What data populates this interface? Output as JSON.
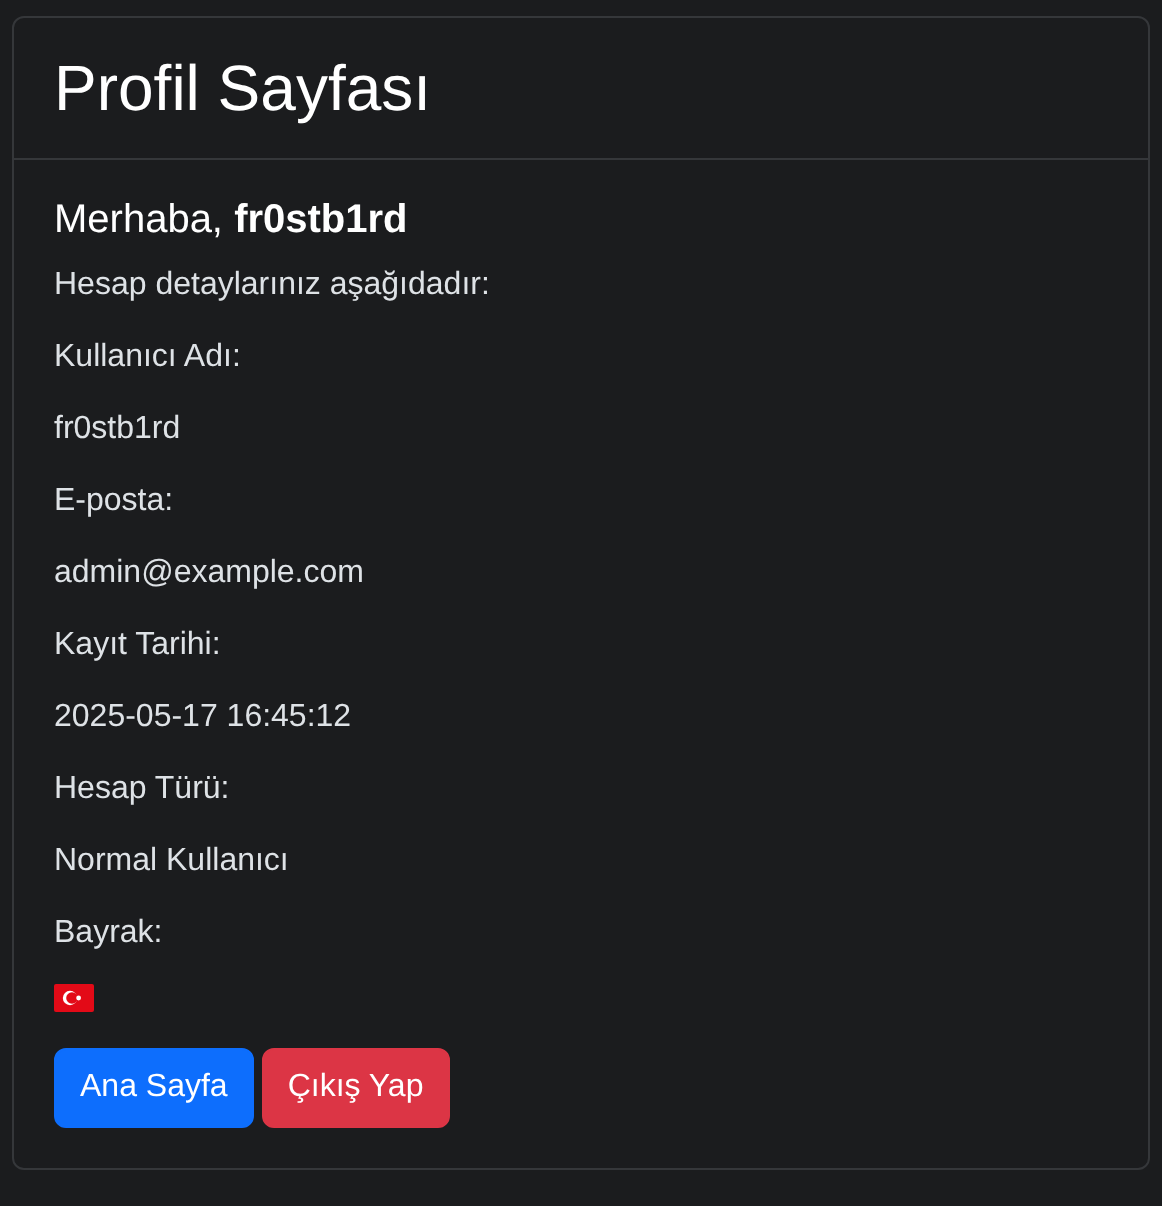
{
  "title": "Profil Sayfası",
  "greeting": "Merhaba, **fr0stb1rd**",
  "intro": "Hesap detaylarınız aşağıdadır:",
  "fields": [
    {
      "label": "Kullanıcı Adı:",
      "value": "fr0stb1rd",
      "kind": "text"
    },
    {
      "label": "E-posta:",
      "value": "admin@example.com",
      "kind": "text"
    },
    {
      "label": "Kayıt Tarihi:",
      "value": "2025-05-17 16:45:12",
      "kind": "text"
    },
    {
      "label": "Hesap Türü:",
      "value": "Normal Kullanıcı",
      "kind": "text"
    },
    {
      "label": "Bayrak:",
      "kind": "flag"
    }
  ],
  "buttons": [
    {
      "label": "Ana Sayfa",
      "kind": "primary"
    },
    {
      "label": "Çıkış Yap",
      "kind": "danger"
    }
  ]
}
